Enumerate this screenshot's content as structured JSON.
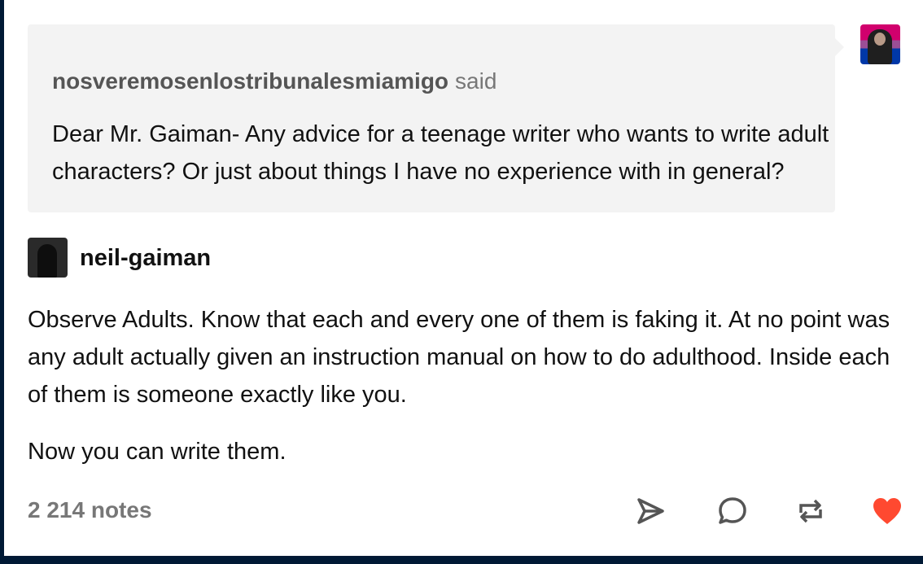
{
  "ask": {
    "asker": "nosveremosenlostribunalesmiamigo",
    "said": "said",
    "question": "Dear Mr. Gaiman- Any advice for a teenage writer who wants to write adult characters? Or just about things I have no experience with in general?"
  },
  "answer": {
    "author": "neil-gaiman",
    "paragraph1": "Observe Adults. Know that each and every one of them is faking it. At no point was any adult actually given an instruction manual on how to do adulthood. Inside each of them is someone exactly like you.",
    "paragraph2": "Now you can write them."
  },
  "footer": {
    "notes": "2 214 notes",
    "actions": [
      "share-icon",
      "reply-icon",
      "reblog-icon",
      "like-icon"
    ],
    "like_color": "#ff4930"
  }
}
